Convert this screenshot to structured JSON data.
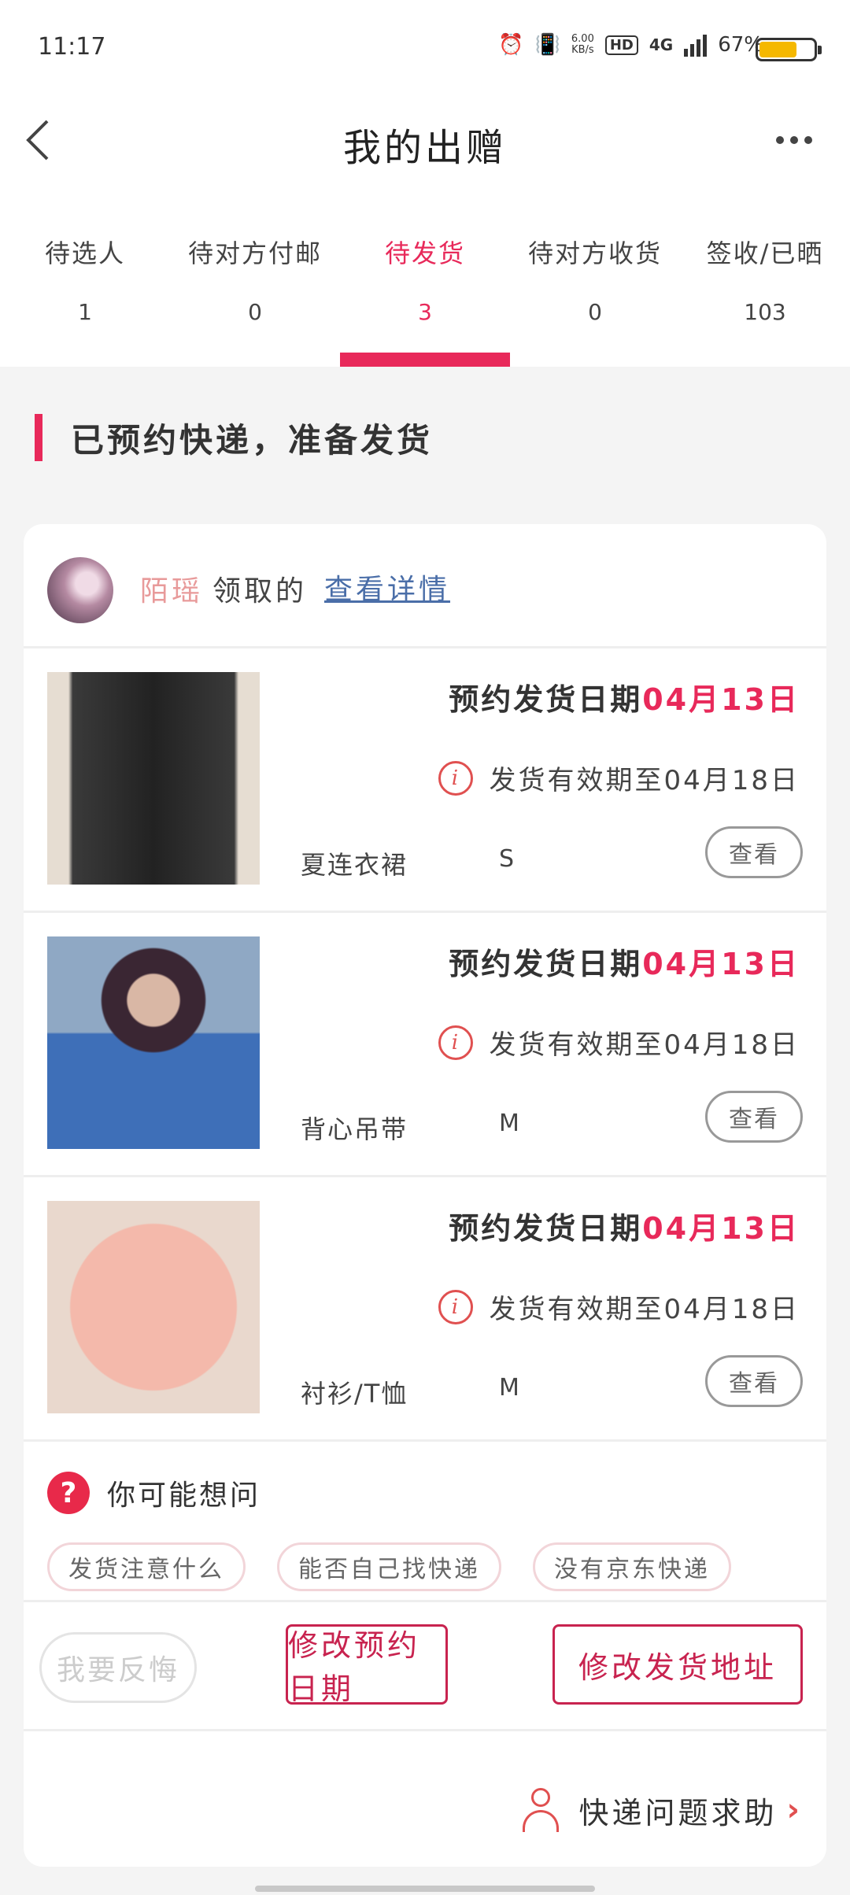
{
  "status_bar": {
    "time": "11:17",
    "net_speed_value": "6.00",
    "net_speed_unit": "KB/s",
    "hd": "HD",
    "network": "4G",
    "battery": "67%",
    "battery_level": 0.67
  },
  "header": {
    "title": "我的出赠"
  },
  "tabs": [
    {
      "label": "待选人",
      "count": "1"
    },
    {
      "label": "待对方付邮",
      "count": "0"
    },
    {
      "label": "待发货",
      "count": "3",
      "active": true
    },
    {
      "label": "待对方收货",
      "count": "0"
    },
    {
      "label": "签收/已晒",
      "count": "103"
    }
  ],
  "section_title": "已预约快递，准备发货",
  "receiver": {
    "name": "陌瑶",
    "suffix": "领取的",
    "link": "查看详情"
  },
  "items": [
    {
      "appointment_label": "预约发货日期",
      "appointment_date": "04月13日",
      "valid_until": "发货有效期至04月18日",
      "name": "夏连衣裙",
      "size": "S",
      "view": "查看"
    },
    {
      "appointment_label": "预约发货日期",
      "appointment_date": "04月13日",
      "valid_until": "发货有效期至04月18日",
      "name": "背心吊带",
      "size": "M",
      "view": "查看"
    },
    {
      "appointment_label": "预约发货日期",
      "appointment_date": "04月13日",
      "valid_until": "发货有效期至04月18日",
      "name": "衬衫/T恤",
      "size": "M",
      "view": "查看"
    }
  ],
  "faq": {
    "title": "你可能想问",
    "chips": [
      "发货注意什么",
      "能否自己找快递",
      "没有京东快递"
    ]
  },
  "actions": {
    "regret": "我要反悔",
    "change_date": "修改预约日期",
    "change_address": "修改发货地址"
  },
  "help": {
    "label": "快递问题求助"
  },
  "colors": {
    "accent": "#e8295a",
    "button": "#c8234f",
    "link": "#4a6ea8"
  }
}
